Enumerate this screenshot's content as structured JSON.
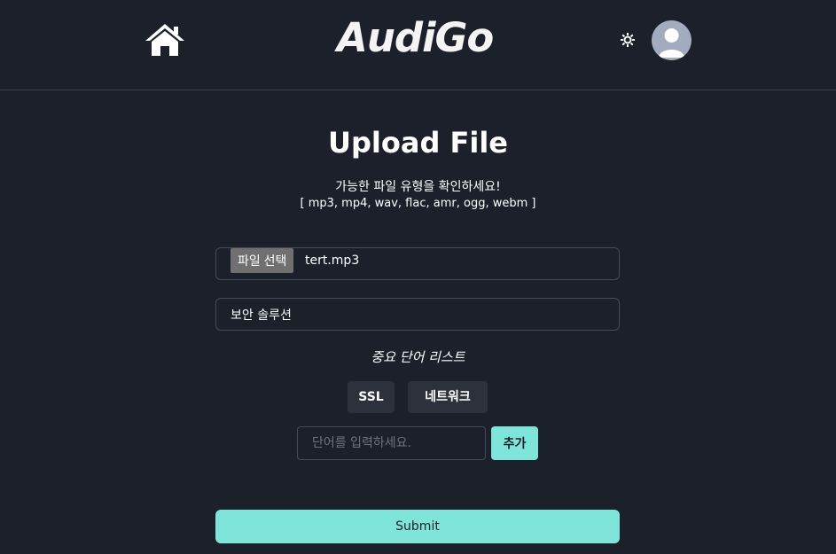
{
  "header": {
    "brand": "AudiGo",
    "home_icon": "home-icon",
    "theme_icon": "sun-icon",
    "avatar_icon": "user-avatar-icon"
  },
  "main": {
    "title": "Upload File",
    "subtitle": "가능한 파일 유형을 확인하세요!",
    "allowed_types": "[ mp3, mp4, wav, flac, amr, ogg, webm ]",
    "file_input": {
      "button_label": "파일 선택",
      "file_name": "tert.mp3"
    },
    "title_field": {
      "value": "보안 솔루션"
    },
    "keywords": {
      "heading": "중요 단어 리스트",
      "items": [
        "SSL",
        "네트워크"
      ],
      "input_placeholder": "단어를 입력하세요.",
      "add_label": "추가"
    },
    "submit_label": "Submit"
  },
  "colors": {
    "background": "#1b202b",
    "accent": "#7fe5da",
    "chip": "#2c313b",
    "border": "#464b57"
  }
}
